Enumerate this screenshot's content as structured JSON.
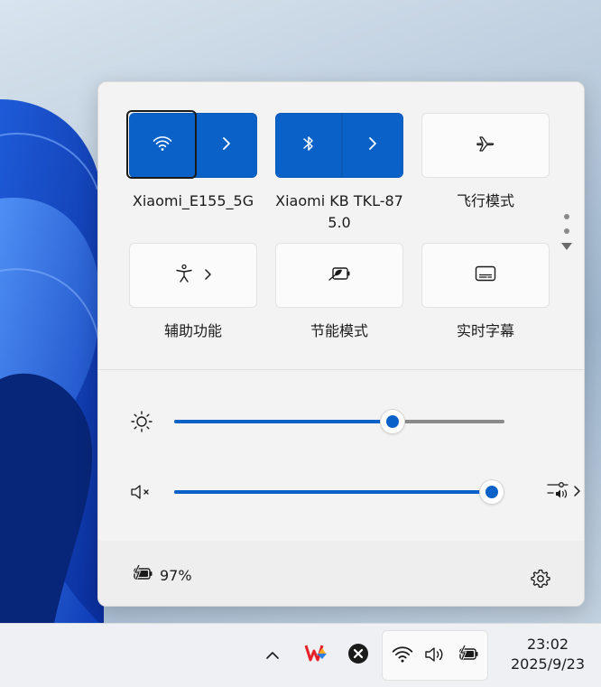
{
  "quick_settings": {
    "tiles": [
      {
        "id": "wifi",
        "label": "Xiaomi_E155_5G",
        "icon": "wifi-icon",
        "active": true
      },
      {
        "id": "bluetooth",
        "label": "Xiaomi KB TKL-87 5.0",
        "label_line1": "Xiaomi KB TKL-87",
        "label_line2": "5.0",
        "icon": "bluetooth-icon",
        "active": true
      },
      {
        "id": "airplane",
        "label": "飞行模式",
        "icon": "airplane-icon",
        "active": false
      },
      {
        "id": "accessibility",
        "label": "辅助功能",
        "icon": "accessibility-icon",
        "active": false
      },
      {
        "id": "energy_saver",
        "label": "节能模式",
        "icon": "energy-saver-icon",
        "active": false
      },
      {
        "id": "live_captions",
        "label": "实时字幕",
        "icon": "live-captions-icon",
        "active": false
      }
    ],
    "brightness": {
      "icon": "brightness-icon",
      "value": 66
    },
    "volume": {
      "icon": "volume-mute-icon",
      "value": 100
    },
    "battery": {
      "icon": "battery-charging-icon",
      "percent_text": "97%"
    },
    "settings_icon": "gear-icon"
  },
  "taskbar": {
    "tray_icons": [
      "chevron-up-icon",
      "wps-icon",
      "close-circle-icon"
    ],
    "system_icons": [
      "wifi-icon",
      "speaker-icon",
      "battery-charging-icon"
    ],
    "time": "23:02",
    "date": "2025/9/23"
  },
  "colors": {
    "accent": "#0a61c8"
  }
}
